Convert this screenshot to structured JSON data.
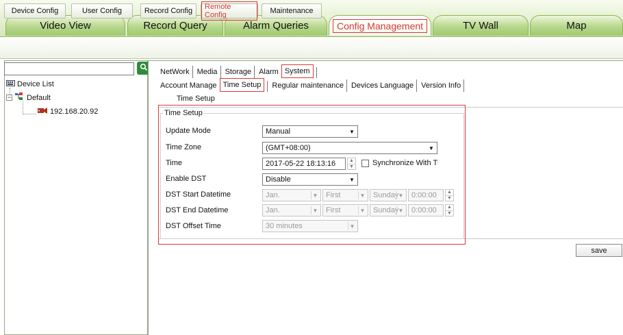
{
  "top_tabs": [
    {
      "label": "Video View"
    },
    {
      "label": "Record Query"
    },
    {
      "label": "Alarm Queries"
    },
    {
      "label": "Config Management"
    },
    {
      "label": "TV Wall"
    },
    {
      "label": "Map"
    }
  ],
  "sub_tabs": [
    {
      "label": "Device Config"
    },
    {
      "label": "User Config"
    },
    {
      "label": "Record Config"
    },
    {
      "label": "Remote Config"
    },
    {
      "label": "Maintenance"
    }
  ],
  "sidebar": {
    "search_value": "",
    "tree": {
      "root": "Device List",
      "group": "Default",
      "device": "192.168.20.92"
    }
  },
  "main_tabs": [
    {
      "label": "NetWork"
    },
    {
      "label": "Media"
    },
    {
      "label": "Storage"
    },
    {
      "label": "Alarm"
    },
    {
      "label": "System"
    }
  ],
  "system_tabs": [
    {
      "label": "Account Manage"
    },
    {
      "label": "Time Setup"
    },
    {
      "label": "Regular maintenance"
    },
    {
      "label": "Devices Language"
    },
    {
      "label": "Version Info"
    }
  ],
  "page_title": "Time Setup",
  "group_title": "Time Setup",
  "form": {
    "update_mode": {
      "label": "Update Mode",
      "value": "Manual"
    },
    "time_zone": {
      "label": "Time Zone",
      "value": "(GMT+08:00)"
    },
    "time": {
      "label": "Time",
      "value": "2017-05-22 18:13:16",
      "sync_label": "Synchronize With Th"
    },
    "enable_dst": {
      "label": "Enable DST",
      "value": "Disable"
    },
    "dst_start": {
      "label": "DST Start Datetime",
      "month": "Jan.",
      "week": "First",
      "day": "Sunday",
      "time": "0:00:00"
    },
    "dst_end": {
      "label": "DST End Datetime",
      "month": "Jan.",
      "week": "First",
      "day": "Sunday",
      "time": "0:00:00"
    },
    "dst_offset": {
      "label": "DST Offset Time",
      "value": "30 minutes"
    }
  },
  "save_label": "save",
  "colors": {
    "highlight": "#d63a3a",
    "tab_green": "#9fc96f"
  }
}
